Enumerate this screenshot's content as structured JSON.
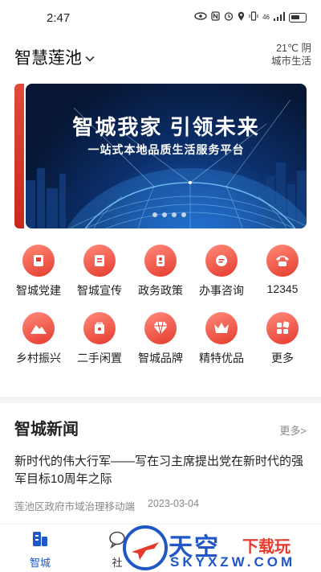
{
  "status_bar": {
    "time": "2:47",
    "signal": "46"
  },
  "header": {
    "city": "智慧莲池",
    "weather_temp": "21℃ 阴",
    "weather_label": "城市生活"
  },
  "banner": {
    "title": "智城我家  引领未来",
    "subtitle": "一站式本地品质生活服务平台",
    "slide_count": 4
  },
  "services": [
    {
      "label": "智城党建",
      "icon": "party-building-icon"
    },
    {
      "label": "智城宣传",
      "icon": "publicity-icon"
    },
    {
      "label": "政务政策",
      "icon": "policy-icon"
    },
    {
      "label": "办事咨询",
      "icon": "consult-icon"
    },
    {
      "label": "12345",
      "icon": "hotline-phone-icon"
    },
    {
      "label": "乡村振兴",
      "icon": "rural-icon"
    },
    {
      "label": "二手闲置",
      "icon": "secondhand-icon"
    },
    {
      "label": "智城品牌",
      "icon": "brand-diamond-icon"
    },
    {
      "label": "精特优品",
      "icon": "crown-icon"
    },
    {
      "label": "更多",
      "icon": "more-grid-icon"
    }
  ],
  "news": {
    "section_title": "智城新闻",
    "more_label": "更多>",
    "headline": "新时代的伟大行军——写在习主席提出党在新时代的强军目标10周年之际",
    "source": "莲池区政府市域治理移动端",
    "date": "2023-03-04"
  },
  "bottom_nav": [
    {
      "label": "智城",
      "active": true
    },
    {
      "label": "社",
      "active": false
    }
  ],
  "watermark": {
    "text": "天空",
    "text2": "下载玩",
    "domain": "SKYXZW.COM"
  },
  "colors": {
    "accent": "#e53b2e",
    "nav_active": "#1f57c8"
  }
}
